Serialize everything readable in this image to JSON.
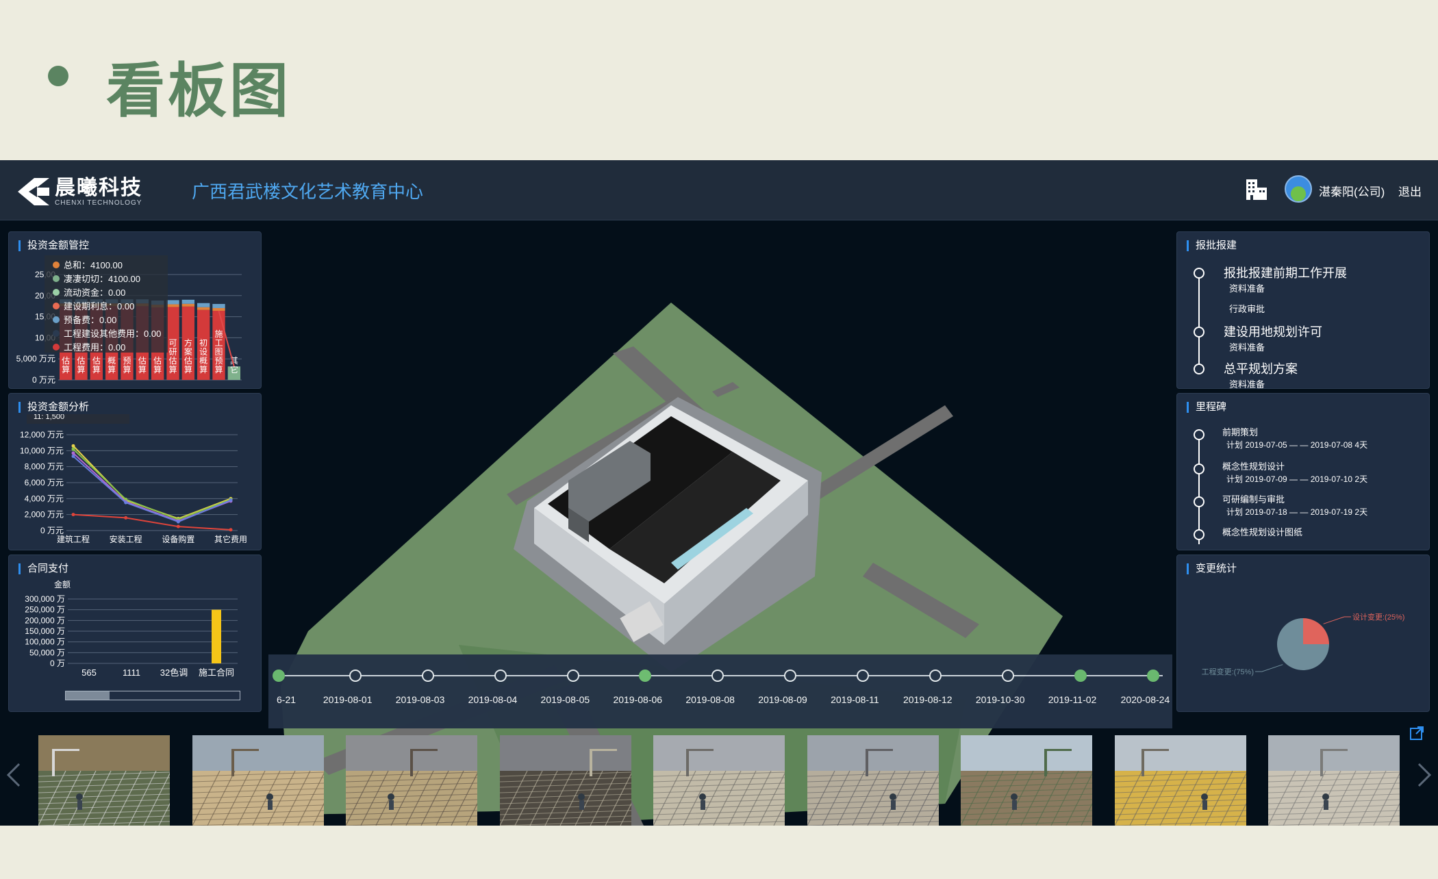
{
  "slide": {
    "title": "看板图"
  },
  "header": {
    "logo_cn": "晨曦科技",
    "logo_en": "CHENXI TECHNOLOGY",
    "project": "广西君武楼文化艺术教育中心",
    "user": "湛秦阳(公司)",
    "logout": "退出",
    "icons": {
      "building": "building-icon",
      "avatar": "user-avatar"
    }
  },
  "invest_control": {
    "title": "投资金额管控",
    "tooltip": [
      {
        "label": "总和：4100.00",
        "color": "#e0823a"
      },
      {
        "label": "凄凄切切：4100.00",
        "color": "#7fb18c"
      },
      {
        "label": "流动资金：0.00",
        "color": "#9ad0a6"
      },
      {
        "label": "建设期利息：0.00",
        "color": "#e96b52"
      },
      {
        "label": "预备费：0.00",
        "color": "#6aa0c8"
      },
      {
        "label": "工程建设其他费用：0.00",
        "color": "#2a3a50"
      },
      {
        "label": "工程费用：0.00",
        "color": "#d43a3a"
      }
    ]
  },
  "invest_analysis": {
    "title": "投资金额分析",
    "tooltip_top": "11: 1,500"
  },
  "contract_pay": {
    "title": "合同支付",
    "legend": "金额"
  },
  "approval": {
    "title": "报批报建",
    "items": [
      {
        "label": "报批报建前期工作开展",
        "subs": [
          "资料准备",
          "行政审批"
        ]
      },
      {
        "label": "建设用地规划许可",
        "subs": [
          "资料准备"
        ]
      },
      {
        "label": "总平规划方案",
        "subs": [
          "资料准备"
        ]
      }
    ]
  },
  "milestone": {
    "title": "里程碑",
    "items": [
      {
        "name": "前期策划",
        "plan": "计划  2019-07-05 — — 2019-07-08   4天"
      },
      {
        "name": "概念性规划设计",
        "plan": "计划  2019-07-09 — — 2019-07-10   2天"
      },
      {
        "name": "可研编制与审批",
        "plan": "计划  2019-07-18 — — 2019-07-19   2天"
      },
      {
        "name": "概念性规划设计图纸",
        "plan": ""
      }
    ]
  },
  "change_stats": {
    "title": "变更统计"
  },
  "timeline": {
    "dates": [
      "6-21",
      "2019-08-01",
      "2019-08-03",
      "2019-08-04",
      "2019-08-05",
      "2019-08-06",
      "2019-08-08",
      "2019-08-09",
      "2019-08-11",
      "2019-08-12",
      "2019-10-30",
      "2019-11-02",
      "2020-08-24"
    ],
    "done": [
      true,
      false,
      false,
      false,
      false,
      true,
      false,
      false,
      false,
      false,
      false,
      true,
      true
    ]
  },
  "photos": {
    "count": 9
  },
  "chart_data": [
    {
      "type": "bar",
      "title": "投资金额管控",
      "ylabel": "",
      "yticks": [
        "0 万元",
        "5,000 万元",
        "10,00",
        "15,00",
        "20,00",
        "25,00"
      ],
      "ylim": [
        0,
        25000
      ],
      "categories": [
        "估算",
        "估算",
        "估算",
        "概算",
        "预算",
        "估算",
        "估算",
        "可研估算",
        "方案估算",
        "初设概算",
        "施工图预算",
        "其它"
      ],
      "series": [
        {
          "name": "总和",
          "values": [
            4100,
            4100,
            4100,
            4100,
            4100,
            4100,
            4100,
            4100,
            4100,
            4100,
            4100,
            4100
          ]
        }
      ],
      "bar_values": [
        17500,
        17500,
        17500,
        17500,
        17500,
        17500,
        17200,
        17300,
        17400,
        16600,
        16400,
        3200
      ],
      "tooltip_values": [
        "总和：4100.00",
        "凄凄切切：4100.00",
        "流动资金：0.00",
        "建设期利息：0.00",
        "预备费：0.00",
        "工程建设其他费用：0.00",
        "工程费用：0.00"
      ]
    },
    {
      "type": "line",
      "title": "投资金额分析",
      "categories": [
        "建筑工程",
        "安装工程",
        "设备购置",
        "其它费用"
      ],
      "yticks": [
        "0 万元",
        "2,000 万元",
        "4,000 万元",
        "6,000 万元",
        "8,000 万元",
        "10,000 万元",
        "12,000 万元"
      ],
      "ylim": [
        0,
        12000
      ],
      "series": [
        {
          "color": "#e8d24a",
          "values": [
            10600,
            3800,
            1500,
            4000
          ]
        },
        {
          "color": "#8bc34a",
          "values": [
            10200,
            3900,
            1400,
            3900
          ]
        },
        {
          "color": "#b06ad0",
          "values": [
            9700,
            3600,
            1200,
            3700
          ]
        },
        {
          "color": "#6a7ee0",
          "values": [
            9300,
            3500,
            1100,
            3800
          ]
        },
        {
          "color": "#e0443a",
          "values": [
            2000,
            1600,
            500,
            100
          ]
        }
      ]
    },
    {
      "type": "bar",
      "title": "合同支付",
      "legend": "金额",
      "categories": [
        "565",
        "1111",
        "32色调",
        "施工合同"
      ],
      "yticks": [
        "0 万",
        "50,000 万",
        "100,000 万",
        "150,000 万",
        "200,000 万",
        "250,000 万",
        "300,000 万"
      ],
      "ylim": [
        0,
        300000
      ],
      "values": [
        0,
        0,
        0,
        250000
      ]
    },
    {
      "type": "pie",
      "title": "变更统计",
      "slices": [
        {
          "label": "设计变更:(25%)",
          "value": 25,
          "color": "#e0645c"
        },
        {
          "label": "工程变更:(75%)",
          "value": 75,
          "color": "#6f8d9a"
        }
      ]
    }
  ]
}
